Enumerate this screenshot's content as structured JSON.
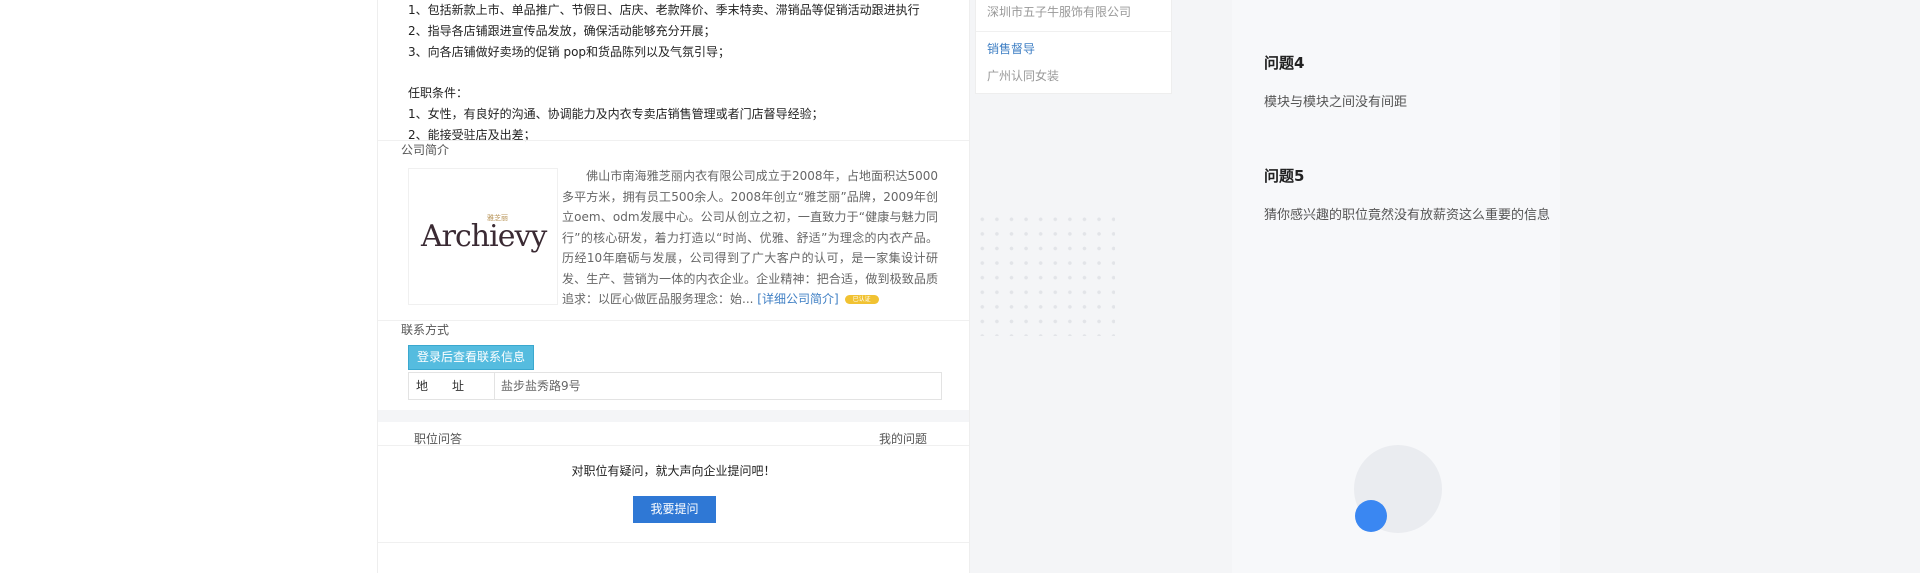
{
  "job_duties": [
    "1、包括新款上市、单品推广、节假日、店庆、老款降价、季末特卖、滞销品等促销活动跟进执行",
    "2、指导各店铺跟进宣传品发放，确保活动能够充分开展；",
    "3、向各店铺做好卖场的促销 pop和货品陈列以及气氛引导；"
  ],
  "requirements_title": "任职条件：",
  "requirements": [
    "1、女性，有良好的沟通、协调能力及内衣专卖店销售管理或者门店督导经验；",
    "2、能接受驻店及出差；"
  ],
  "company": {
    "section_title": "公司简介",
    "logo_text": "Archievy",
    "logo_mark": "雅芝丽",
    "intro": "佛山市南海雅芝丽内衣有限公司成立于2008年，占地面积达5000多平方米，拥有员工500余人。2008年创立“雅芝丽”品牌，2009年创立oem、odm发展中心。公司从创立之初，一直致力于“健康与魅力同行”的核心研发，着力打造以“时尚、优雅、舒适”为理念的内衣产品。历经10年磨砺与发展，公司得到了广大客户的认可，是一家集设计研发、生产、营销为一体的内衣企业。企业精神：把合适，做到极致品质追求：以匠心做匠品服务理念：始...",
    "more_link": "[详细公司简介]",
    "badge": "已认证"
  },
  "contact": {
    "section_title": "联系方式",
    "login_button": "登录后查看联系信息",
    "address_label": "地址",
    "address_value": "盐步盐秀路9号"
  },
  "qa": {
    "tab_left": "职位问答",
    "tab_right": "我的问题",
    "prompt": "对职位有疑问，就大声向企业提问吧！",
    "ask_button": "我要提问"
  },
  "sidebar": {
    "company_top": "深圳市五子牛服饰有限公司",
    "job_link": "销售督导",
    "company_bottom": "广州认同女装"
  },
  "issues": [
    {
      "title": "问题4",
      "text": "模块与模块之间没有间距"
    },
    {
      "title": "问题5",
      "text": "猜你感兴趣的职位竟然没有放薪资这么重要的信息"
    }
  ],
  "colors": {
    "accent_blue": "#2f78d5",
    "login_button": "#55bcdf",
    "link_blue": "#3f7fc4",
    "circle_blue": "#3a87f2"
  }
}
